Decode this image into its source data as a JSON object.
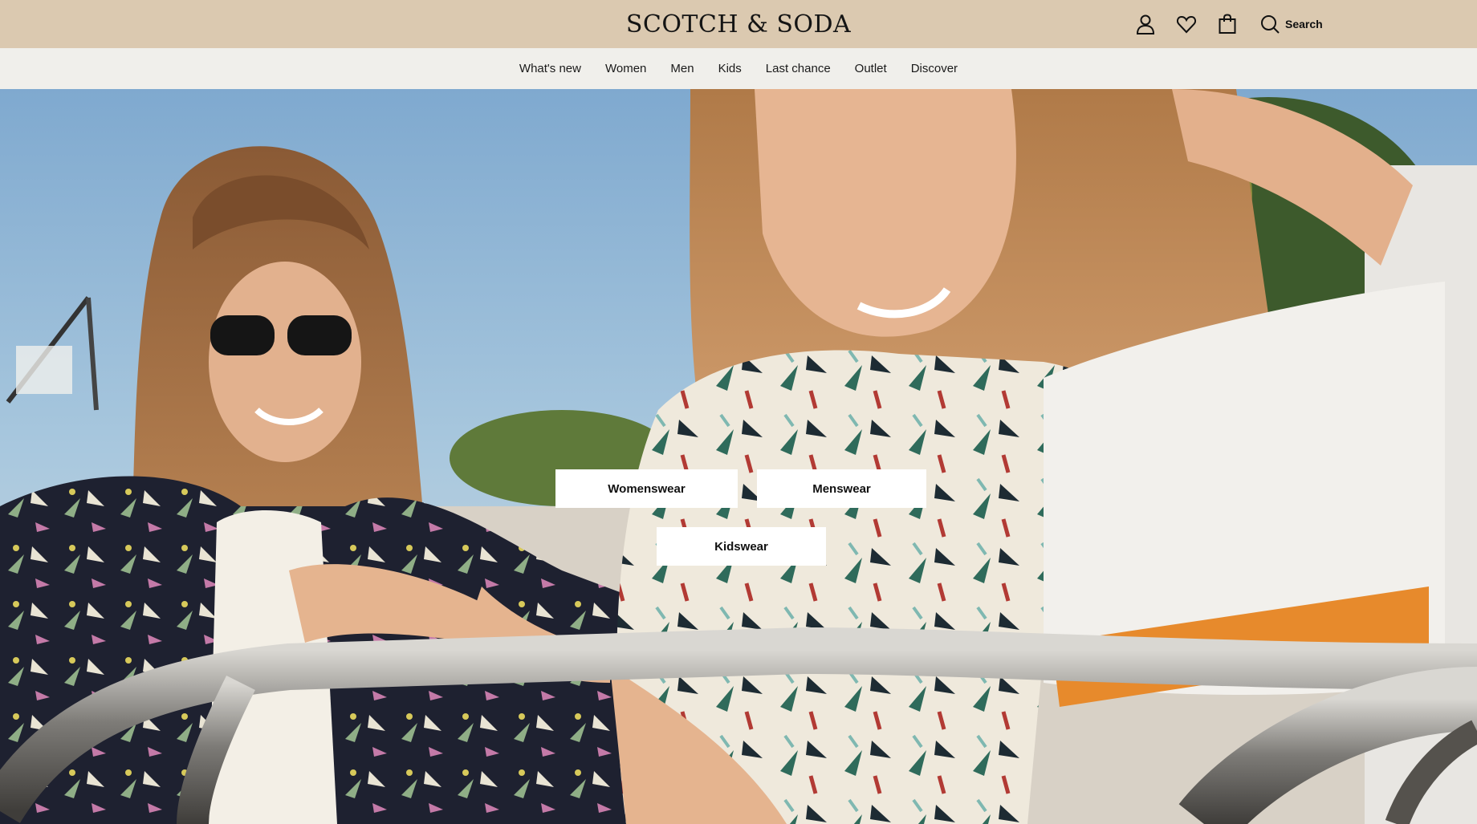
{
  "header": {
    "logo_text": "SCOTCH & SODA",
    "background": "#dbc9b0",
    "icons": [
      "account-icon",
      "wishlist-heart-icon",
      "shopping-bag-icon",
      "search-icon"
    ],
    "search_label": "Search"
  },
  "nav": {
    "background": "#f0efeb",
    "items": [
      {
        "label": "What's new"
      },
      {
        "label": "Women"
      },
      {
        "label": "Men"
      },
      {
        "label": "Kids"
      },
      {
        "label": "Last chance"
      },
      {
        "label": "Outlet"
      },
      {
        "label": "Discover"
      }
    ]
  },
  "hero": {
    "image": "photo-two-models-in-tropical-print-shirts-leaning-on-metal-railing",
    "buttons": {
      "womenswear": "Womenswear",
      "menswear": "Menswear",
      "kidswear": "Kidswear"
    }
  }
}
